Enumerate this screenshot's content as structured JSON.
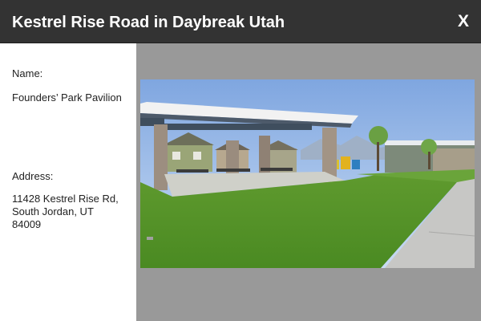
{
  "header": {
    "title": "Kestrel Rise Road in Daybreak Utah",
    "close_label": "X"
  },
  "details": {
    "name_label": "Name:",
    "name_value": "Founders’ Park Pavilion",
    "address_label": "Address:",
    "address_lines": [
      "11428 Kestrel Rise Rd,",
      "South Jordan, UT",
      "84009"
    ]
  },
  "colors": {
    "titlebar": "#333333",
    "panel_bg": "#999999",
    "sidebar_bg": "#ffffff"
  }
}
